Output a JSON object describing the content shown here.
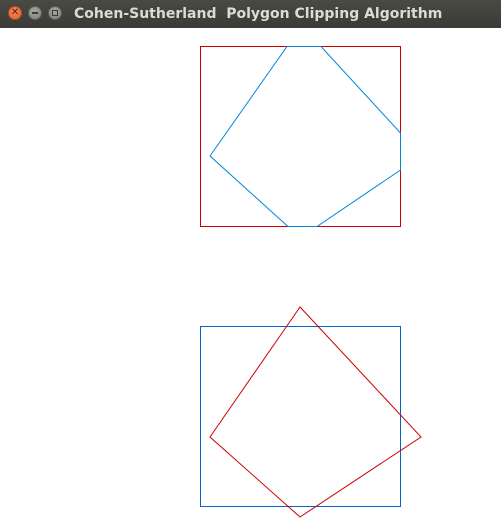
{
  "window": {
    "title": "Cohen-Sutherland  Polygon Clipping Algorithm",
    "buttons": {
      "close_icon": "close-icon",
      "minimize_icon": "minimize-icon",
      "maximize_icon": "maximize-icon"
    }
  },
  "colors": {
    "red": "#cc0000",
    "blue": "#0066cc",
    "titlebar": "#3c3b37",
    "title_text": "#dfdbd2",
    "close_button": "#e8572c"
  }
}
